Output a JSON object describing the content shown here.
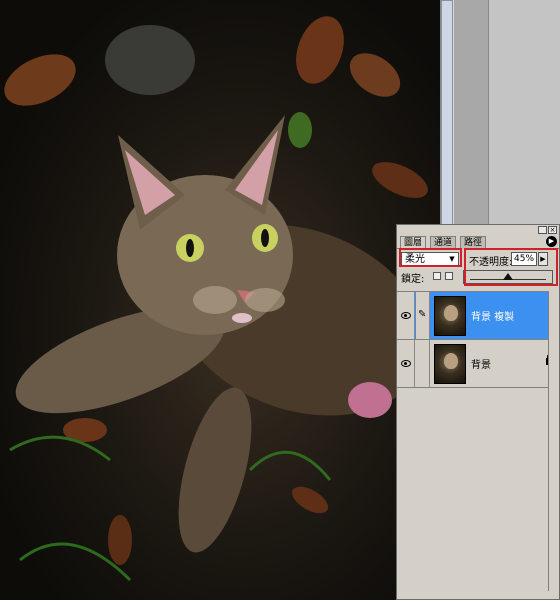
{
  "palette": {
    "tabs": [
      {
        "label": "圖層",
        "active": true
      },
      {
        "label": "通道",
        "active": false
      },
      {
        "label": "路徑",
        "active": false
      }
    ],
    "blend_mode": "柔光",
    "opacity_label": "不透明度:",
    "opacity_value": "45%",
    "lock_label": "鎖定:",
    "layers": [
      {
        "name": "背景 複製",
        "selected": true,
        "visible": true
      },
      {
        "name": "背景",
        "selected": false,
        "visible": true,
        "locked": true
      }
    ]
  },
  "icons": {
    "menu": "palette-menu-icon",
    "eye": "eye-icon",
    "brush": "brush-icon",
    "lock": "lock-icon"
  },
  "colors": {
    "selection": "#3c90f0",
    "highlight": "#d0202a",
    "palette_bg": "#d4d0c8"
  }
}
